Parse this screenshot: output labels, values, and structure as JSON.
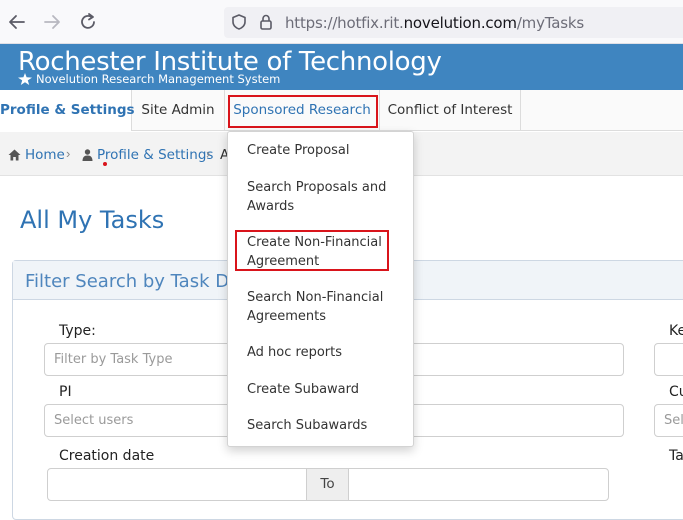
{
  "browser": {
    "url_prefix": "https://hotfix.rit.",
    "url_domain": "novelution.com",
    "url_path": "/myTasks"
  },
  "header": {
    "title": "Rochester Institute of Technology",
    "subtitle": "Novelution Research Management System"
  },
  "tabs": [
    {
      "label": "Profile & Settings"
    },
    {
      "label": "Site Admin"
    },
    {
      "label": "Sponsored Research"
    },
    {
      "label": "Conflict of Interest"
    }
  ],
  "breadcrumb": {
    "home": "Home",
    "profile": "Profile & Settings",
    "current_fragment": "A"
  },
  "page_title": "All My Tasks",
  "dropdown": {
    "items": [
      {
        "label": "Create Proposal"
      },
      {
        "label": "Search Proposals and Awards"
      },
      {
        "label": "Create Non-Financial Agreement"
      },
      {
        "label": "Search Non-Financial Agreements"
      },
      {
        "label": "Ad hoc reports"
      },
      {
        "label": "Create Subaward"
      },
      {
        "label": "Search Subawards"
      }
    ]
  },
  "filter": {
    "panel_title": "Filter Search by Task Det",
    "type_label": "Type:",
    "type_placeholder": "Filter by Task Type",
    "pi_label": "PI",
    "pi_placeholder": "Select users",
    "creation_label": "Creation date",
    "to_label": "To",
    "right_label_1": "Ke",
    "right_label_2": "Cu",
    "right_placeholder_2": "Sele",
    "right_label_3": "Ta"
  },
  "colors": {
    "header_blue": "#3f85c0",
    "link_blue": "#2f73b3",
    "highlight_red": "#d9141b"
  }
}
